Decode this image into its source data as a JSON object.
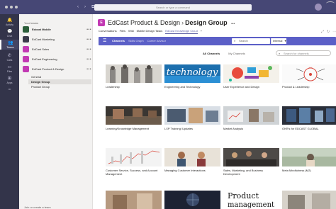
{
  "topbar": {
    "search_placeholder": "Search or type a command",
    "back": "‹",
    "forward": "›",
    "compose": "⧉"
  },
  "rail": [
    {
      "label": "Activity",
      "icon": "bell-icon",
      "glyph": "🔔"
    },
    {
      "label": "Chat",
      "icon": "chat-icon",
      "glyph": "💬"
    },
    {
      "label": "Teams",
      "icon": "teams-icon",
      "glyph": "👥"
    },
    {
      "label": "Calls",
      "icon": "phone-icon",
      "glyph": "✆"
    },
    {
      "label": "Files",
      "icon": "file-icon",
      "glyph": "▭"
    },
    {
      "label": "Apps",
      "icon": "apps-icon",
      "glyph": "⊞"
    }
  ],
  "rail_more": "•••",
  "teams": {
    "title": "Your teams",
    "items": [
      {
        "name": "Edcast Mobile",
        "color": "#2c5e3a"
      },
      {
        "name": "EdCast Marketing",
        "color": "#3a3a4a"
      },
      {
        "name": "EdCast Sales",
        "color": "#c239b3"
      },
      {
        "name": "EdCast Engineering",
        "color": "#c239b3"
      },
      {
        "name": "EdCast Product & Design",
        "color": "#c239b3"
      }
    ],
    "channels": [
      "General",
      "Design Group",
      "Product Group"
    ],
    "join": "Join or create a team",
    "more": "•••"
  },
  "header": {
    "team": "EdCast Product & Design",
    "channel": "Design Group",
    "more": "•••",
    "tabs": [
      "Conversations",
      "Files",
      "Wiki",
      "Mobile Design Tasks",
      "EdCast Knowledge Cloud",
      "+"
    ],
    "active_tab": 4
  },
  "appbar": {
    "menu": "☰",
    "nav": [
      "Channels",
      "Skills Graph",
      "Career Advisor"
    ],
    "search_placeholder": "Search",
    "scope": "Internal"
  },
  "filters": {
    "all": "All Channels",
    "mine": "My Channels",
    "search_placeholder": "Search for channels"
  },
  "tiles": [
    {
      "label": "Leadership",
      "art": "leadership"
    },
    {
      "label": "Engineering and Technology",
      "art": "technology",
      "text": "technology"
    },
    {
      "label": "User Experience and Design",
      "art": "ux"
    },
    {
      "label": "Product & Leadership",
      "art": "product"
    },
    {
      "label": "Learning/Knowledge Management",
      "art": "learning"
    },
    {
      "label": "LXP Training/ Updates",
      "art": "lxp"
    },
    {
      "label": "Market Analysis",
      "art": "market"
    },
    {
      "label": "OKR's for EDCAST GLOBAL",
      "art": "okr"
    },
    {
      "label": "Customer Service, Success, and Account Management",
      "art": "service"
    },
    {
      "label": "Managing Customer Interactions",
      "art": "interactions"
    },
    {
      "label": "Sales, Marketing, and Business Development",
      "art": "sales"
    },
    {
      "label": "Meta Mindfulness (M2)",
      "art": "meta"
    },
    {
      "label": "",
      "art": "row4a"
    },
    {
      "label": "",
      "art": "row4b"
    },
    {
      "label": "",
      "art": "productmgmt",
      "text1": "Product",
      "text2": "management"
    },
    {
      "label": "",
      "art": "row4d"
    }
  ]
}
